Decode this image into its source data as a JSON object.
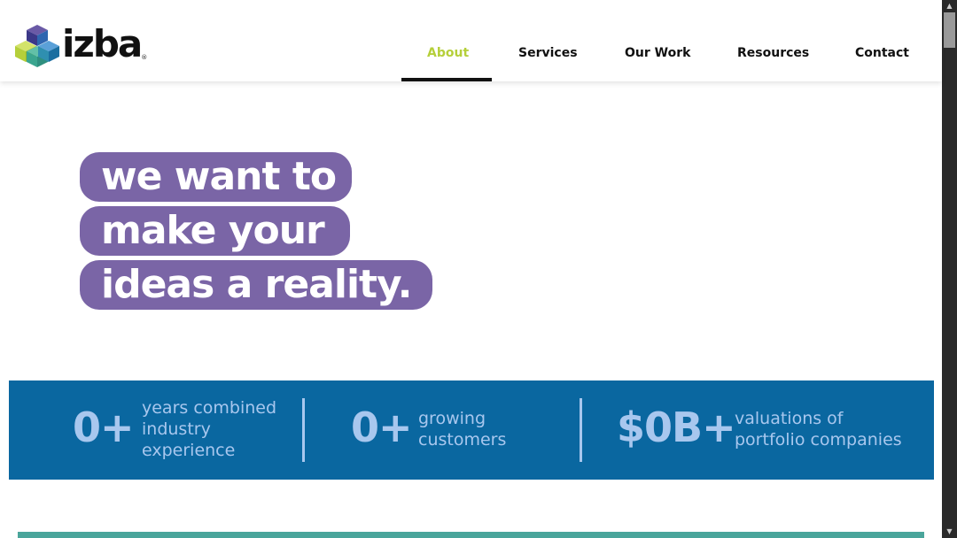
{
  "brand": {
    "name": "izba",
    "registered": "®",
    "colors": {
      "purple": "#7a65a6",
      "blue": "#0a67a0",
      "lime": "#b5cf3a",
      "teal": "#4aa59b",
      "light_blue": "#a8c7ee"
    }
  },
  "nav": {
    "items": [
      {
        "label": "About",
        "active": true
      },
      {
        "label": "Services",
        "active": false
      },
      {
        "label": "Our Work",
        "active": false
      },
      {
        "label": "Resources",
        "active": false
      },
      {
        "label": "Contact",
        "active": false
      }
    ]
  },
  "hero": {
    "lines": [
      "we want to",
      "make your",
      "ideas a reality."
    ]
  },
  "stats": [
    {
      "value": "0+",
      "label_lines": [
        "years combined",
        "industry",
        "experience"
      ]
    },
    {
      "value": "0+",
      "label_lines": [
        "growing",
        "customers"
      ]
    },
    {
      "value": "$0B+",
      "label_lines": [
        "valuations of",
        "portfolio companies"
      ]
    }
  ],
  "scrollbar": {
    "up_icon": "triangle-up-icon",
    "down_icon": "triangle-down-icon"
  }
}
